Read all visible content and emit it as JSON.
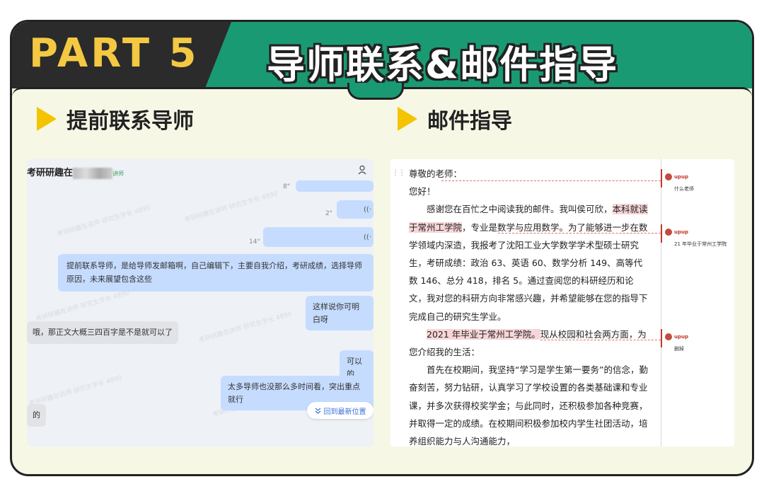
{
  "header": {
    "part_label": "PART 5",
    "title": "导师联系&邮件指导"
  },
  "left_section": {
    "title": "提前联系导师"
  },
  "right_section": {
    "title": "邮件指导"
  },
  "chat": {
    "header_title": "考研研趣在",
    "header_suffix": "讲师",
    "voice_symbol": "((·",
    "durations": [
      "8\"",
      "2\"",
      "14\""
    ],
    "messages": [
      "提前联系导师，是给导师发邮箱啊，自己编辑下，主要自我介绍，考研成绩，选择导师原因，未来展望包含这些",
      "这样说你可明白呀",
      "哦，那正文大概三四百字是不是就可以了",
      "可以的",
      "太多导师也没那么多时间看，突出重点就行",
      "的"
    ],
    "back_to_latest": "回到最新位置",
    "watermark": "考研研趣在讲师 研究生学长 4890"
  },
  "doc": {
    "greeting": "尊敬的老师：",
    "hello": "您好！",
    "p1_a": "感谢您在百忙之中阅读我的邮件。我叫侯可欣，",
    "p1_hl": "本科就读于常州工学院",
    "p1_b": "，专业是数学与应用数学。为了能够进一步在数学领域内深造，我报考了沈阳工业大学数学学术型硕士研究生，考研成绩：政治 63、英语 60、数学分析 149、高等代数 146、总分 418，排名 5。通过查阅您的科研经历和论文，我对您的科研方向非常感兴趣，并希望能够在您的指导下完成自己的研究生学业。",
    "p2_hl": "2021 年毕业于常州工学院。",
    "p2_b": "现从校园和社会两方面，为您介绍我的生活：",
    "p3": "首先在校期间，我坚持“学习是学生第一要务”的信念，勤奋刻苦，努力钻研，认真学习了学校设置的各类基础课和专业课，并多次获得校奖学金；与此同时，还积极参加各种竞赛，并取得一定的成绩。在校期间积极参加校内学生社团活动，培养组织能力与人沟通能力，",
    "comments": [
      {
        "user": "upup",
        "text": "什么老师"
      },
      {
        "user": "upup",
        "text": "21 年毕业于常州工学院"
      },
      {
        "user": "upup",
        "text": "删掉"
      }
    ]
  },
  "colors": {
    "green": "#1a9a73",
    "dark": "#2b2b2b",
    "yellow": "#f4c842",
    "bubble_blue": "#c5dcff",
    "highlight_pink": "#f8d6d8"
  }
}
